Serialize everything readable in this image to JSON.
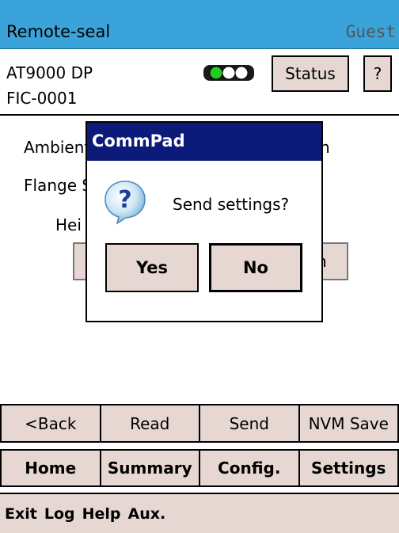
{
  "app": {
    "title": "Remote-seal",
    "user": "Guest"
  },
  "device": {
    "model": "AT9000 DP",
    "tag": "FIC-0001"
  },
  "header_buttons": {
    "status": "Status",
    "help": "?"
  },
  "status_light": {
    "icon": "traffic-light-icon",
    "active_color": "#22cc22"
  },
  "background_fields": {
    "ambient": "Ambient",
    "flange": "Flange S",
    "height": "Hei",
    "right_text": "n",
    "right_button": "n"
  },
  "dialog": {
    "title": "CommPad",
    "message": "Send settings?",
    "icon": "question-icon",
    "yes": "Yes",
    "no": "No"
  },
  "actions": [
    "<Back",
    "Read",
    "Send",
    "NVM Save"
  ],
  "tabs": [
    "Home",
    "Summary",
    "Config.",
    "Settings"
  ],
  "menu": [
    "Exit",
    "Log",
    "Help",
    "Aux."
  ],
  "colors": {
    "titlebar": "#3aa3d9",
    "button": "#e7d7d2",
    "dialog_title": "#0c1a7a"
  }
}
